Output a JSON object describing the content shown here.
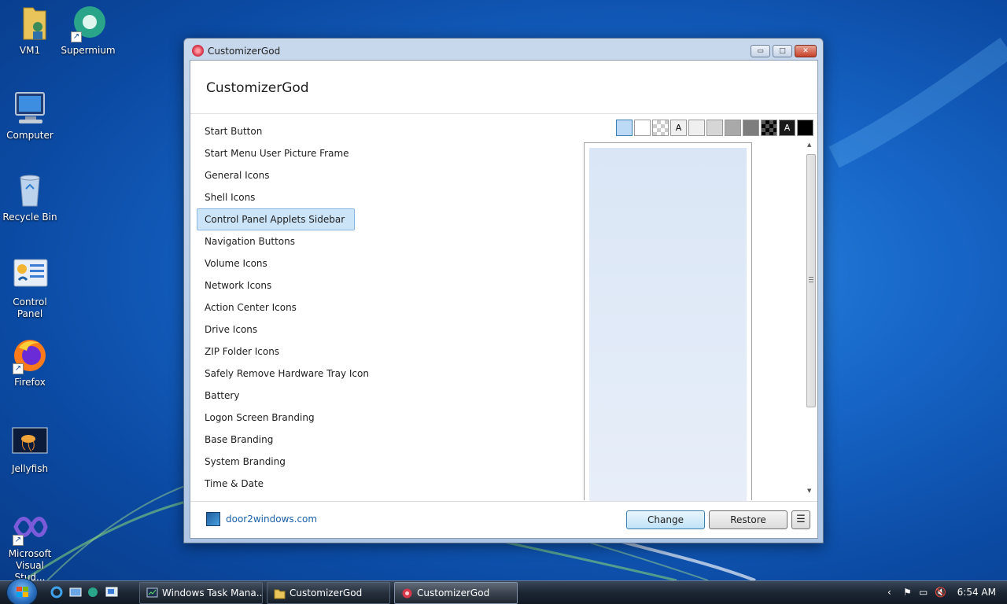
{
  "desktop": {
    "icons": [
      {
        "label": "VM1",
        "icon": "folder-user-icon"
      },
      {
        "label": "Supermium",
        "icon": "supermium-icon"
      },
      {
        "label": "Computer",
        "icon": "computer-icon"
      },
      {
        "label": "Recycle Bin",
        "icon": "recycle-bin-icon"
      },
      {
        "label": "Control Panel",
        "icon": "control-panel-icon"
      },
      {
        "label": "Firefox",
        "icon": "firefox-icon"
      },
      {
        "label": "Jellyfish",
        "icon": "jellyfish-image-icon"
      },
      {
        "label": "Microsoft Visual Stud...",
        "icon": "visual-studio-icon"
      }
    ]
  },
  "window": {
    "title": "CustomizerGod",
    "header_title": "CustomizerGod",
    "controls": {
      "minimize": "▭",
      "maximize": "□",
      "close": "✕"
    }
  },
  "list": {
    "selected_index": 4,
    "items": [
      "Start Button",
      "Start Menu User Picture Frame",
      "General Icons",
      "Shell Icons",
      "Control Panel Applets Sidebar",
      "Navigation Buttons",
      "Volume Icons",
      "Network Icons",
      "Action Center Icons",
      "Drive Icons",
      "ZIP Folder Icons",
      "Safely Remove Hardware Tray Icon",
      "Battery",
      "Logon Screen Branding",
      "Base Branding",
      "System Branding",
      "Time & Date"
    ]
  },
  "swatches": [
    {
      "name": "light-blue",
      "color": "#bcd9f5",
      "text": ""
    },
    {
      "name": "white",
      "color": "#ffffff",
      "text": ""
    },
    {
      "name": "checker",
      "color": "#e6e6e6",
      "text": ""
    },
    {
      "name": "text-light",
      "color": "#f0f0f0",
      "text": "A"
    },
    {
      "name": "very-light-gray",
      "color": "#efefef",
      "text": ""
    },
    {
      "name": "light-gray",
      "color": "#d6d6d6",
      "text": ""
    },
    {
      "name": "gray",
      "color": "#a9a9a9",
      "text": ""
    },
    {
      "name": "dark-gray",
      "color": "#7d7d7d",
      "text": ""
    },
    {
      "name": "dark-checker",
      "color": "#3a3a3a",
      "text": ""
    },
    {
      "name": "text-dark",
      "color": "#1a1a1a",
      "text": "A"
    },
    {
      "name": "black",
      "color": "#000000",
      "text": ""
    }
  ],
  "footer": {
    "site_link": "door2windows.com",
    "change_label": "Change",
    "restore_label": "Restore",
    "menu_label": "☰"
  },
  "taskbar": {
    "tasks": [
      {
        "label": "Windows Task Mana...",
        "icon": "task-manager-icon",
        "active": false
      },
      {
        "label": "CustomizerGod",
        "icon": "folder-icon",
        "active": false
      },
      {
        "label": "CustomizerGod",
        "icon": "customizergod-icon",
        "active": true
      }
    ],
    "clock": "6:54 AM"
  }
}
